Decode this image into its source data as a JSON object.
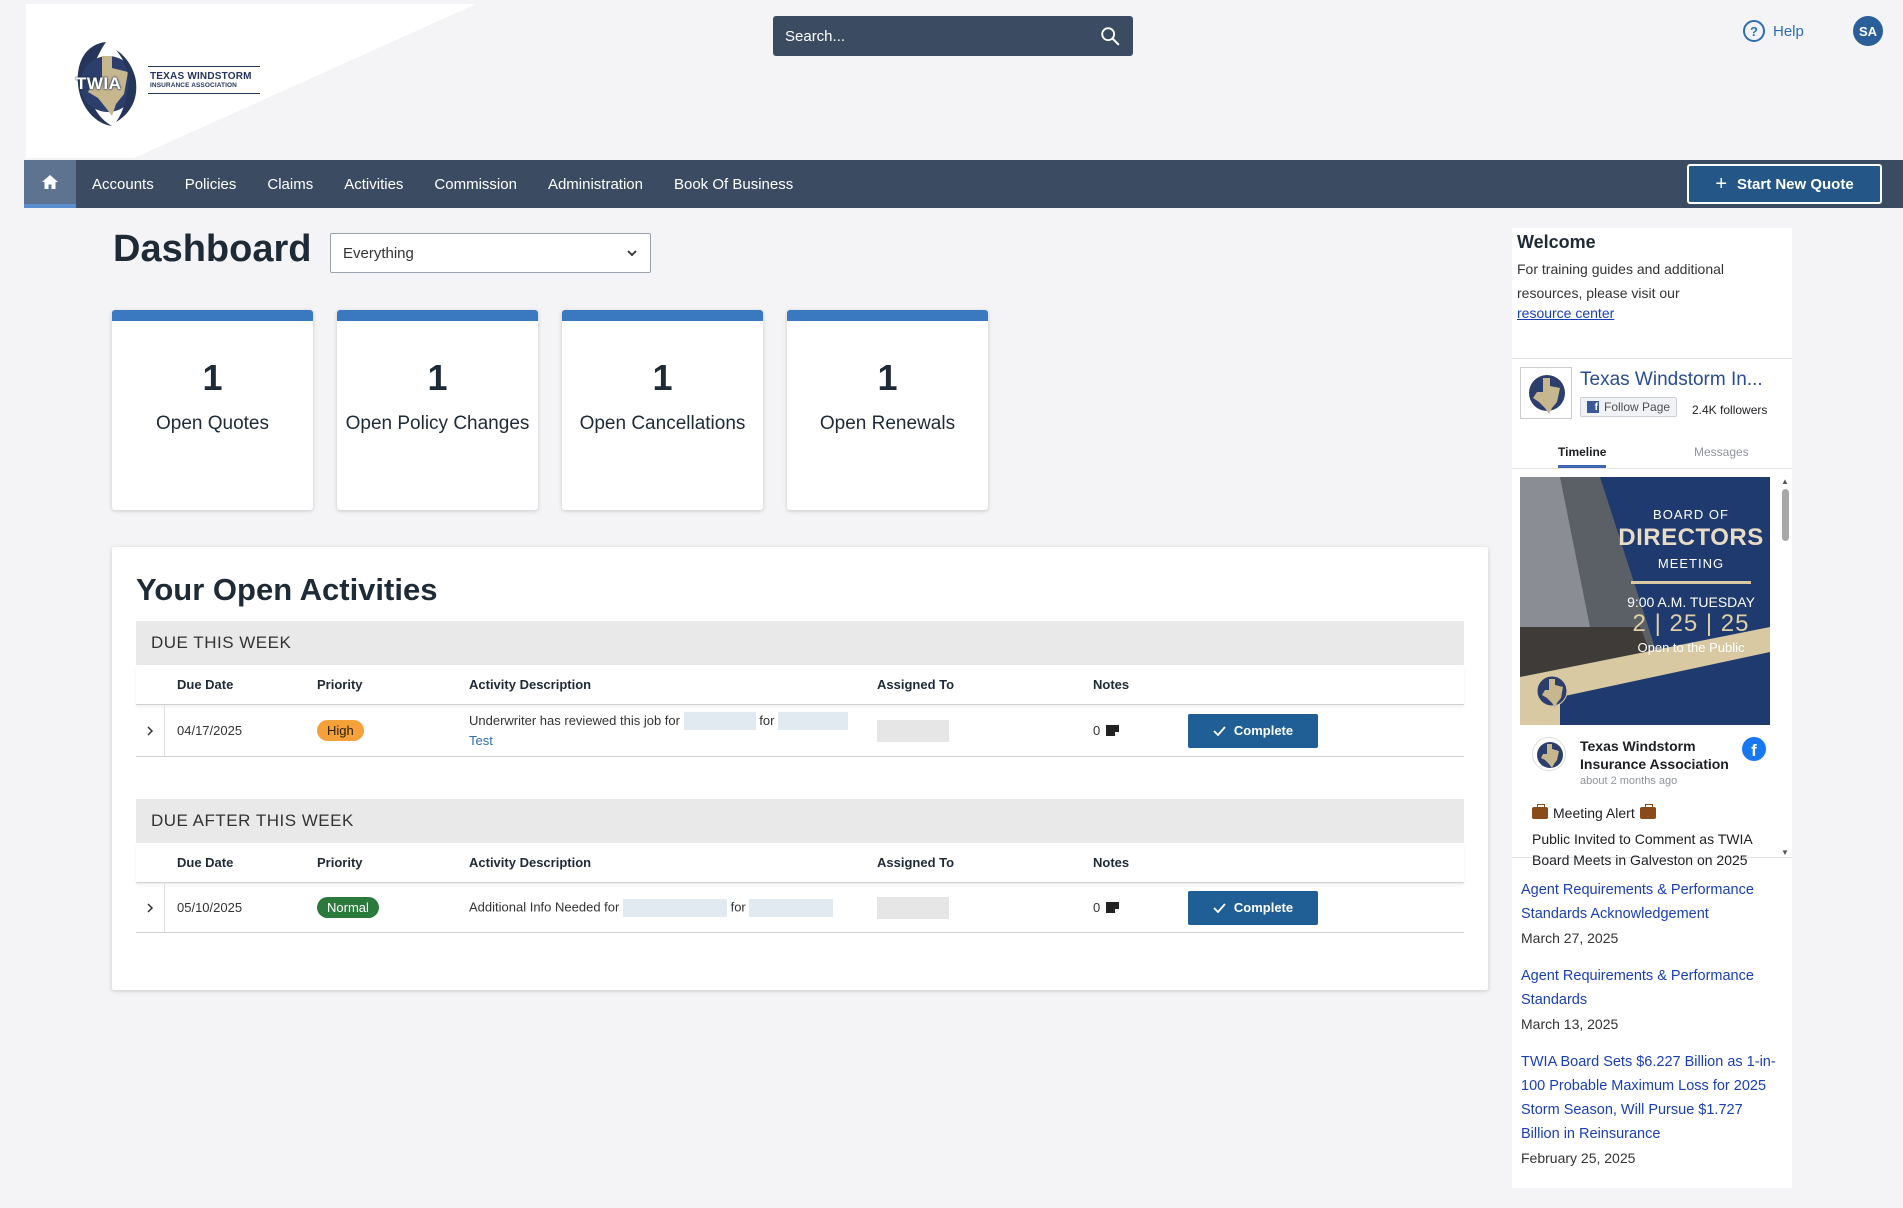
{
  "brand": {
    "logo_badge": "TWIA",
    "logo_line1": "TEXAS WINDSTORM",
    "logo_line2": "INSURANCE ASSOCIATION"
  },
  "header": {
    "search_placeholder": "Search...",
    "help_label": "Help",
    "avatar_initials": "SA"
  },
  "nav": {
    "items": [
      "Accounts",
      "Policies",
      "Claims",
      "Activities",
      "Commission",
      "Administration",
      "Book Of Business"
    ],
    "start_quote_label": "Start New Quote"
  },
  "dashboard": {
    "title": "Dashboard",
    "filter_value": "Everything",
    "cards": [
      {
        "count": "1",
        "label": "Open Quotes"
      },
      {
        "count": "1",
        "label": "Open Policy Changes"
      },
      {
        "count": "1",
        "label": "Open Cancellations"
      },
      {
        "count": "1",
        "label": "Open Renewals"
      }
    ]
  },
  "activities": {
    "title": "Your Open Activities",
    "columns": [
      "Due Date",
      "Priority",
      "Activity Description",
      "Assigned To",
      "Notes"
    ],
    "complete_label": "Complete",
    "sections": [
      {
        "heading": "DUE THIS WEEK",
        "rows": [
          {
            "due_date": "04/17/2025",
            "priority": "High",
            "desc_prefix": "Underwriter has reviewed this job for",
            "desc_mid": "for",
            "desc_link": "Test",
            "notes": "0"
          }
        ]
      },
      {
        "heading": "DUE AFTER THIS WEEK",
        "rows": [
          {
            "due_date": "05/10/2025",
            "priority": "Normal",
            "desc_prefix": "Additional Info Needed for",
            "desc_mid": "for",
            "desc_link": "",
            "notes": "0"
          }
        ]
      }
    ]
  },
  "welcome": {
    "title": "Welcome",
    "text": "For training guides and additional resources, please visit our",
    "link": "resource center"
  },
  "facebook": {
    "page_name": "Texas Windstorm In...",
    "follow_label": "Follow Page",
    "followers": "2.4K followers",
    "tabs": [
      "Timeline",
      "Messages"
    ],
    "post_image": {
      "line1": "BOARD OF",
      "line2": "DIRECTORS",
      "line3": "MEETING",
      "line4": "9:00 A.M. TUESDAY",
      "line5": "2 | 25 | 25",
      "line6": "Open to the Public"
    },
    "post_author": "Texas Windstorm Insurance Association",
    "post_time": "about 2 months ago",
    "post_alert": "Meeting Alert",
    "post_body": "Public Invited to Comment as TWIA Board Meets in Galveston on 2025"
  },
  "news": [
    {
      "title": "Agent Requirements & Performance Standards Acknowledgement",
      "date": "March 27, 2025"
    },
    {
      "title": "Agent Requirements & Performance Standards",
      "date": "March 13, 2025"
    },
    {
      "title": "TWIA Board Sets $6.227 Billion as 1-in-100 Probable Maximum Loss for 2025 Storm Season, Will Pursue $1.727 Billion in Reinsurance",
      "date": "February 25, 2025"
    }
  ],
  "colors": {
    "nav_bg": "#3b4b61",
    "card_accent": "#3a78bf",
    "complete_button": "#1f5f95",
    "priority_high": "#f5a13a",
    "priority_normal": "#2b7a3c",
    "link": "#1a3fb5"
  },
  "icons": [
    "home-icon",
    "search-icon",
    "help-icon",
    "chevron-down-icon",
    "plus-icon",
    "expand-chevron-icon",
    "note-icon",
    "check-icon",
    "facebook-icon",
    "briefcase-icon"
  ]
}
